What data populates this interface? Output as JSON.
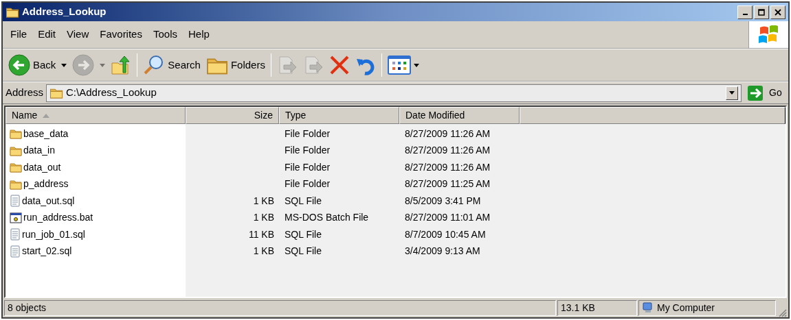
{
  "window": {
    "title": "Address_Lookup"
  },
  "menu": [
    {
      "label": "File"
    },
    {
      "label": "Edit"
    },
    {
      "label": "View"
    },
    {
      "label": "Favorites"
    },
    {
      "label": "Tools"
    },
    {
      "label": "Help"
    }
  ],
  "toolbar": [
    {
      "kind": "back",
      "label": "Back",
      "disabled": false
    },
    {
      "kind": "forward",
      "disabled": true
    },
    {
      "kind": "up",
      "disabled": false
    },
    {
      "kind": "separator"
    },
    {
      "kind": "search",
      "label": "Search",
      "disabled": false
    },
    {
      "kind": "folders",
      "label": "Folders",
      "disabled": false
    },
    {
      "kind": "separator"
    },
    {
      "kind": "move",
      "disabled": true
    },
    {
      "kind": "copy",
      "disabled": true
    },
    {
      "kind": "delete",
      "disabled": false
    },
    {
      "kind": "undo",
      "disabled": false
    },
    {
      "kind": "separator"
    },
    {
      "kind": "views",
      "disabled": false
    }
  ],
  "address": {
    "label": "Address",
    "value": "C:\\Address_Lookup",
    "go": "Go"
  },
  "table": {
    "columns": [
      {
        "label": "Name",
        "sorted": true
      },
      {
        "label": "Size",
        "sorted": false
      },
      {
        "label": "Type",
        "sorted": false
      },
      {
        "label": "Date Modified",
        "sorted": false
      }
    ],
    "rows": [
      {
        "kind": "folder",
        "name": "base_data",
        "size": "",
        "type": "File Folder",
        "date": "8/27/2009 11:26 AM"
      },
      {
        "kind": "folder",
        "name": "data_in",
        "size": "",
        "type": "File Folder",
        "date": "8/27/2009 11:26 AM"
      },
      {
        "kind": "folder",
        "name": "data_out",
        "size": "",
        "type": "File Folder",
        "date": "8/27/2009 11:26 AM"
      },
      {
        "kind": "folder",
        "name": "p_address",
        "size": "",
        "type": "File Folder",
        "date": "8/27/2009 11:25 AM"
      },
      {
        "kind": "text",
        "name": "data_out.sql",
        "size": "1 KB",
        "type": "SQL File",
        "date": "8/5/2009 3:41 PM"
      },
      {
        "kind": "batch",
        "name": "run_address.bat",
        "size": "1 KB",
        "type": "MS-DOS Batch File",
        "date": "8/27/2009 11:01 AM"
      },
      {
        "kind": "text",
        "name": "run_job_01.sql",
        "size": "11 KB",
        "type": "SQL File",
        "date": "8/7/2009 10:45 AM"
      },
      {
        "kind": "text",
        "name": "start_02.sql",
        "size": "1 KB",
        "type": "SQL File",
        "date": "3/4/2009 9:13 AM"
      }
    ]
  },
  "status_bar": {
    "objects": "8 objects",
    "size": "13.1 KB",
    "zone": "My Computer"
  }
}
